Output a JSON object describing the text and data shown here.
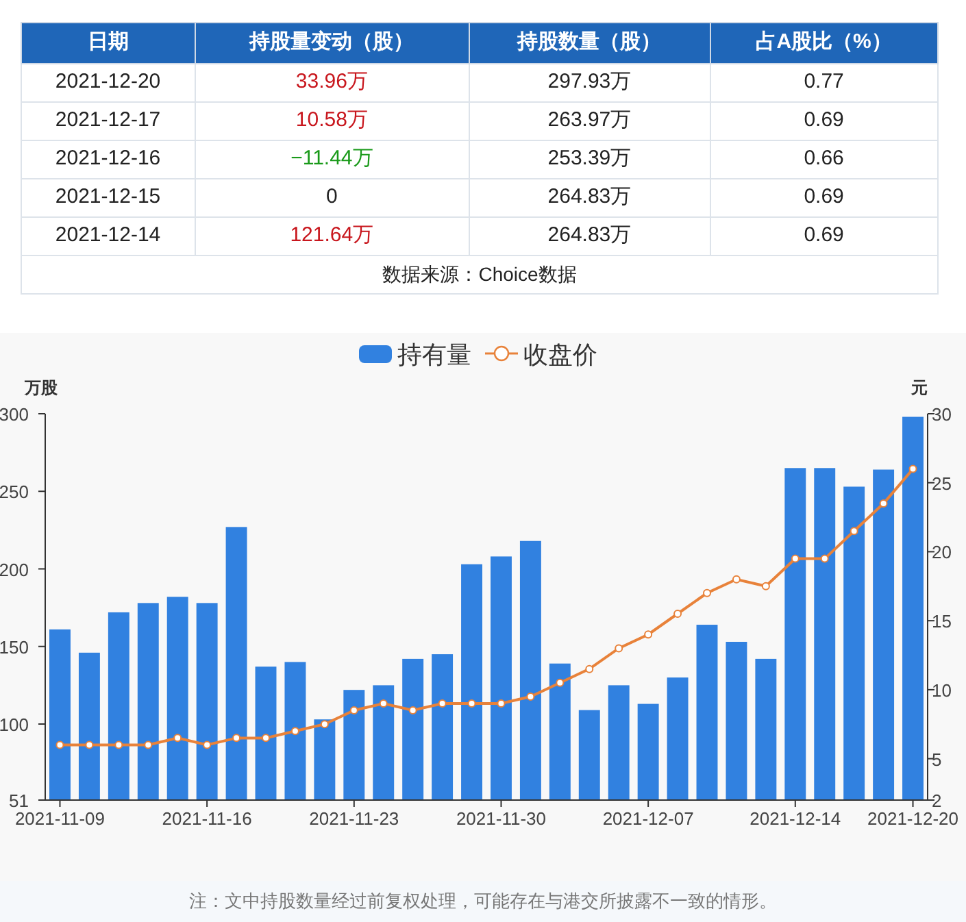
{
  "table": {
    "columns": [
      "日期",
      "持股量变动（股）",
      "持股数量（股）",
      "占A股比（%）"
    ],
    "rows": [
      {
        "date": "2021-12-20",
        "change": "33.96万",
        "color": "#c8161d",
        "holding": "297.93万",
        "ratio": "0.77"
      },
      {
        "date": "2021-12-17",
        "change": "10.58万",
        "color": "#c8161d",
        "holding": "263.97万",
        "ratio": "0.69"
      },
      {
        "date": "2021-12-16",
        "change": "−11.44万",
        "color": "#1a9a1a",
        "holding": "253.39万",
        "ratio": "0.66"
      },
      {
        "date": "2021-12-15",
        "change": "0",
        "color": "#222222",
        "holding": "264.83万",
        "ratio": "0.69"
      },
      {
        "date": "2021-12-14",
        "change": "121.64万",
        "color": "#c8161d",
        "holding": "264.83万",
        "ratio": "0.69"
      }
    ],
    "source": "数据来源：Choice数据"
  },
  "chart": {
    "chart_data": {
      "type": "bar",
      "legend": "top",
      "ylabel": "万股",
      "y2label": "元",
      "categories": [
        "2021-11-09",
        null,
        null,
        null,
        null,
        "2021-11-16",
        null,
        null,
        null,
        null,
        "2021-11-23",
        null,
        null,
        null,
        null,
        "2021-11-30",
        null,
        null,
        null,
        null,
        "2021-12-07",
        null,
        null,
        null,
        null,
        "2021-12-14",
        null,
        null,
        null,
        "2021-12-20"
      ],
      "ylim": [
        51,
        300
      ],
      "yticks": [
        51,
        100,
        150,
        200,
        250,
        300
      ],
      "y2lim": [
        2,
        30
      ],
      "y2ticks": [
        2,
        5,
        10,
        15,
        20,
        25,
        30
      ],
      "series": [
        {
          "name": "持有量",
          "color": "#3181e0",
          "values": [
            161,
            146,
            172,
            178,
            182,
            178,
            227,
            137,
            140,
            103,
            122,
            125,
            142,
            145,
            203,
            208,
            218,
            139,
            109,
            125,
            113,
            130,
            164,
            153,
            142,
            265,
            265,
            253,
            264,
            298
          ]
        },
        {
          "name": "收盘价",
          "type": "line",
          "marker": "circle",
          "axis": "y2",
          "color": "#e8823a",
          "values": [
            6,
            6,
            6,
            6,
            6.5,
            6,
            6.5,
            6.5,
            7,
            7.5,
            8.5,
            9,
            8.5,
            9,
            9,
            9,
            9.5,
            10.5,
            11.5,
            13,
            14,
            15.5,
            17,
            18,
            17.5,
            19.5,
            19.5,
            21.5,
            23.5,
            26
          ]
        }
      ]
    }
  },
  "note": "注：文中持股数量经过前复权处理，可能存在与港交所披露不一致的情形。"
}
